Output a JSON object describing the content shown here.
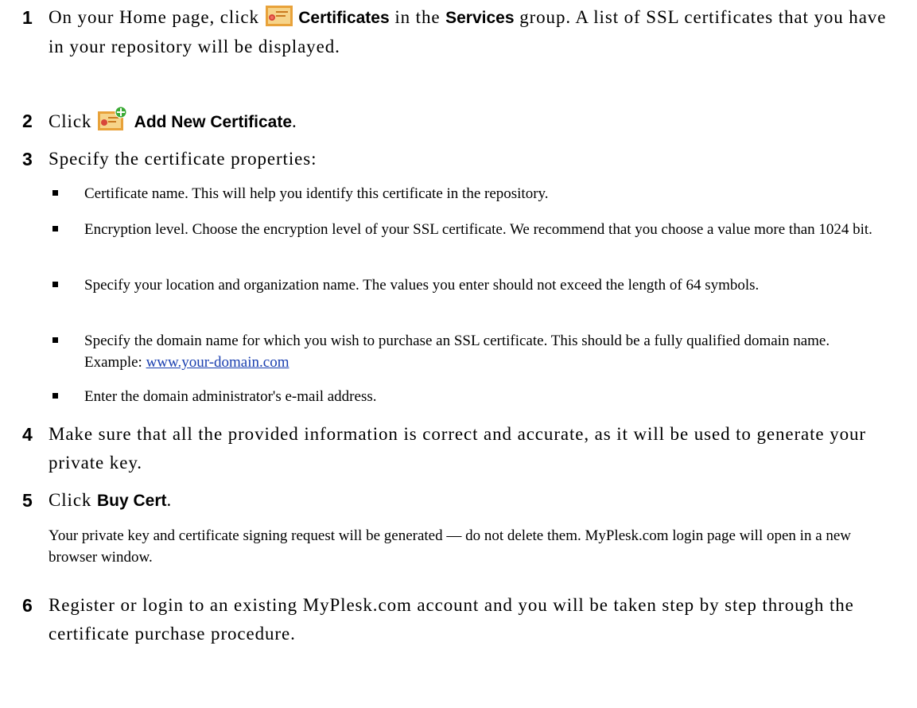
{
  "steps": [
    {
      "number": "1",
      "text_before": "On your Home page, click",
      "icon": "certificate-icon",
      "ui_label": "Certificates",
      "text_mid": "in the",
      "ui_label_2": "Services",
      "text_after": "group. A list of SSL certificates that you have in your repository will be displayed."
    },
    {
      "number": "2",
      "text_before": "Click",
      "icon": "add-certificate-icon",
      "ui_label": "Add New Certificate",
      "text_after": "."
    },
    {
      "number": "3",
      "text": "Specify the certificate properties:"
    },
    {
      "number": "4",
      "text": "Make sure that all the provided information is correct and accurate, as it will be used to generate your private key."
    },
    {
      "number": "5",
      "text_before": "Click",
      "ui_label": "Buy Cert",
      "text_after": "."
    },
    {
      "number": "6",
      "text": "Register or login to an existing MyPlesk.com account and you will be taken step by step through the certificate purchase procedure."
    }
  ],
  "bullets": [
    "Certificate name. This will help you identify this certificate in the repository.",
    "Encryption level. Choose the encryption level of your SSL certificate. We recommend that you choose a value more than 1024 bit.",
    "Specify your location and organization name. The values you enter should not exceed the length of 64 symbols.",
    {
      "text": "Specify the domain name for which you wish to purchase an SSL certificate. This should be a fully qualified domain name. Example:",
      "link": "www.your-domain.com"
    },
    "Enter the domain administrator's e-mail address."
  ],
  "step5_note": "Your private key and certificate signing request will be generated — do not delete them. MyPlesk.com login page will open in a new browser window.",
  "colors": {
    "link": "#1a3fb0",
    "icon_frame": "#e8a23a",
    "icon_fill": "#f6d48a",
    "plus_badge": "#3aaa35"
  }
}
